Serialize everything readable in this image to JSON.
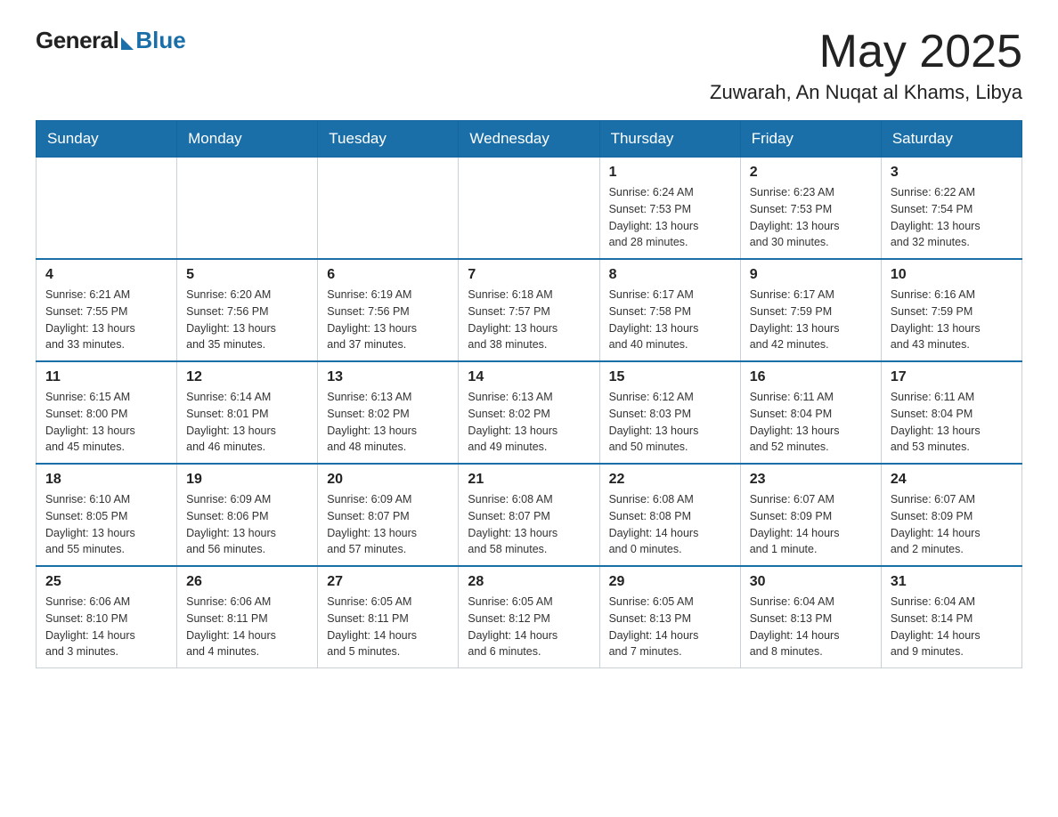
{
  "header": {
    "logo_general": "General",
    "logo_blue": "Blue",
    "title": "May 2025",
    "subtitle": "Zuwarah, An Nuqat al Khams, Libya"
  },
  "days_of_week": [
    "Sunday",
    "Monday",
    "Tuesday",
    "Wednesday",
    "Thursday",
    "Friday",
    "Saturday"
  ],
  "weeks": [
    [
      {
        "day": "",
        "info": ""
      },
      {
        "day": "",
        "info": ""
      },
      {
        "day": "",
        "info": ""
      },
      {
        "day": "",
        "info": ""
      },
      {
        "day": "1",
        "info": "Sunrise: 6:24 AM\nSunset: 7:53 PM\nDaylight: 13 hours\nand 28 minutes."
      },
      {
        "day": "2",
        "info": "Sunrise: 6:23 AM\nSunset: 7:53 PM\nDaylight: 13 hours\nand 30 minutes."
      },
      {
        "day": "3",
        "info": "Sunrise: 6:22 AM\nSunset: 7:54 PM\nDaylight: 13 hours\nand 32 minutes."
      }
    ],
    [
      {
        "day": "4",
        "info": "Sunrise: 6:21 AM\nSunset: 7:55 PM\nDaylight: 13 hours\nand 33 minutes."
      },
      {
        "day": "5",
        "info": "Sunrise: 6:20 AM\nSunset: 7:56 PM\nDaylight: 13 hours\nand 35 minutes."
      },
      {
        "day": "6",
        "info": "Sunrise: 6:19 AM\nSunset: 7:56 PM\nDaylight: 13 hours\nand 37 minutes."
      },
      {
        "day": "7",
        "info": "Sunrise: 6:18 AM\nSunset: 7:57 PM\nDaylight: 13 hours\nand 38 minutes."
      },
      {
        "day": "8",
        "info": "Sunrise: 6:17 AM\nSunset: 7:58 PM\nDaylight: 13 hours\nand 40 minutes."
      },
      {
        "day": "9",
        "info": "Sunrise: 6:17 AM\nSunset: 7:59 PM\nDaylight: 13 hours\nand 42 minutes."
      },
      {
        "day": "10",
        "info": "Sunrise: 6:16 AM\nSunset: 7:59 PM\nDaylight: 13 hours\nand 43 minutes."
      }
    ],
    [
      {
        "day": "11",
        "info": "Sunrise: 6:15 AM\nSunset: 8:00 PM\nDaylight: 13 hours\nand 45 minutes."
      },
      {
        "day": "12",
        "info": "Sunrise: 6:14 AM\nSunset: 8:01 PM\nDaylight: 13 hours\nand 46 minutes."
      },
      {
        "day": "13",
        "info": "Sunrise: 6:13 AM\nSunset: 8:02 PM\nDaylight: 13 hours\nand 48 minutes."
      },
      {
        "day": "14",
        "info": "Sunrise: 6:13 AM\nSunset: 8:02 PM\nDaylight: 13 hours\nand 49 minutes."
      },
      {
        "day": "15",
        "info": "Sunrise: 6:12 AM\nSunset: 8:03 PM\nDaylight: 13 hours\nand 50 minutes."
      },
      {
        "day": "16",
        "info": "Sunrise: 6:11 AM\nSunset: 8:04 PM\nDaylight: 13 hours\nand 52 minutes."
      },
      {
        "day": "17",
        "info": "Sunrise: 6:11 AM\nSunset: 8:04 PM\nDaylight: 13 hours\nand 53 minutes."
      }
    ],
    [
      {
        "day": "18",
        "info": "Sunrise: 6:10 AM\nSunset: 8:05 PM\nDaylight: 13 hours\nand 55 minutes."
      },
      {
        "day": "19",
        "info": "Sunrise: 6:09 AM\nSunset: 8:06 PM\nDaylight: 13 hours\nand 56 minutes."
      },
      {
        "day": "20",
        "info": "Sunrise: 6:09 AM\nSunset: 8:07 PM\nDaylight: 13 hours\nand 57 minutes."
      },
      {
        "day": "21",
        "info": "Sunrise: 6:08 AM\nSunset: 8:07 PM\nDaylight: 13 hours\nand 58 minutes."
      },
      {
        "day": "22",
        "info": "Sunrise: 6:08 AM\nSunset: 8:08 PM\nDaylight: 14 hours\nand 0 minutes."
      },
      {
        "day": "23",
        "info": "Sunrise: 6:07 AM\nSunset: 8:09 PM\nDaylight: 14 hours\nand 1 minute."
      },
      {
        "day": "24",
        "info": "Sunrise: 6:07 AM\nSunset: 8:09 PM\nDaylight: 14 hours\nand 2 minutes."
      }
    ],
    [
      {
        "day": "25",
        "info": "Sunrise: 6:06 AM\nSunset: 8:10 PM\nDaylight: 14 hours\nand 3 minutes."
      },
      {
        "day": "26",
        "info": "Sunrise: 6:06 AM\nSunset: 8:11 PM\nDaylight: 14 hours\nand 4 minutes."
      },
      {
        "day": "27",
        "info": "Sunrise: 6:05 AM\nSunset: 8:11 PM\nDaylight: 14 hours\nand 5 minutes."
      },
      {
        "day": "28",
        "info": "Sunrise: 6:05 AM\nSunset: 8:12 PM\nDaylight: 14 hours\nand 6 minutes."
      },
      {
        "day": "29",
        "info": "Sunrise: 6:05 AM\nSunset: 8:13 PM\nDaylight: 14 hours\nand 7 minutes."
      },
      {
        "day": "30",
        "info": "Sunrise: 6:04 AM\nSunset: 8:13 PM\nDaylight: 14 hours\nand 8 minutes."
      },
      {
        "day": "31",
        "info": "Sunrise: 6:04 AM\nSunset: 8:14 PM\nDaylight: 14 hours\nand 9 minutes."
      }
    ]
  ]
}
